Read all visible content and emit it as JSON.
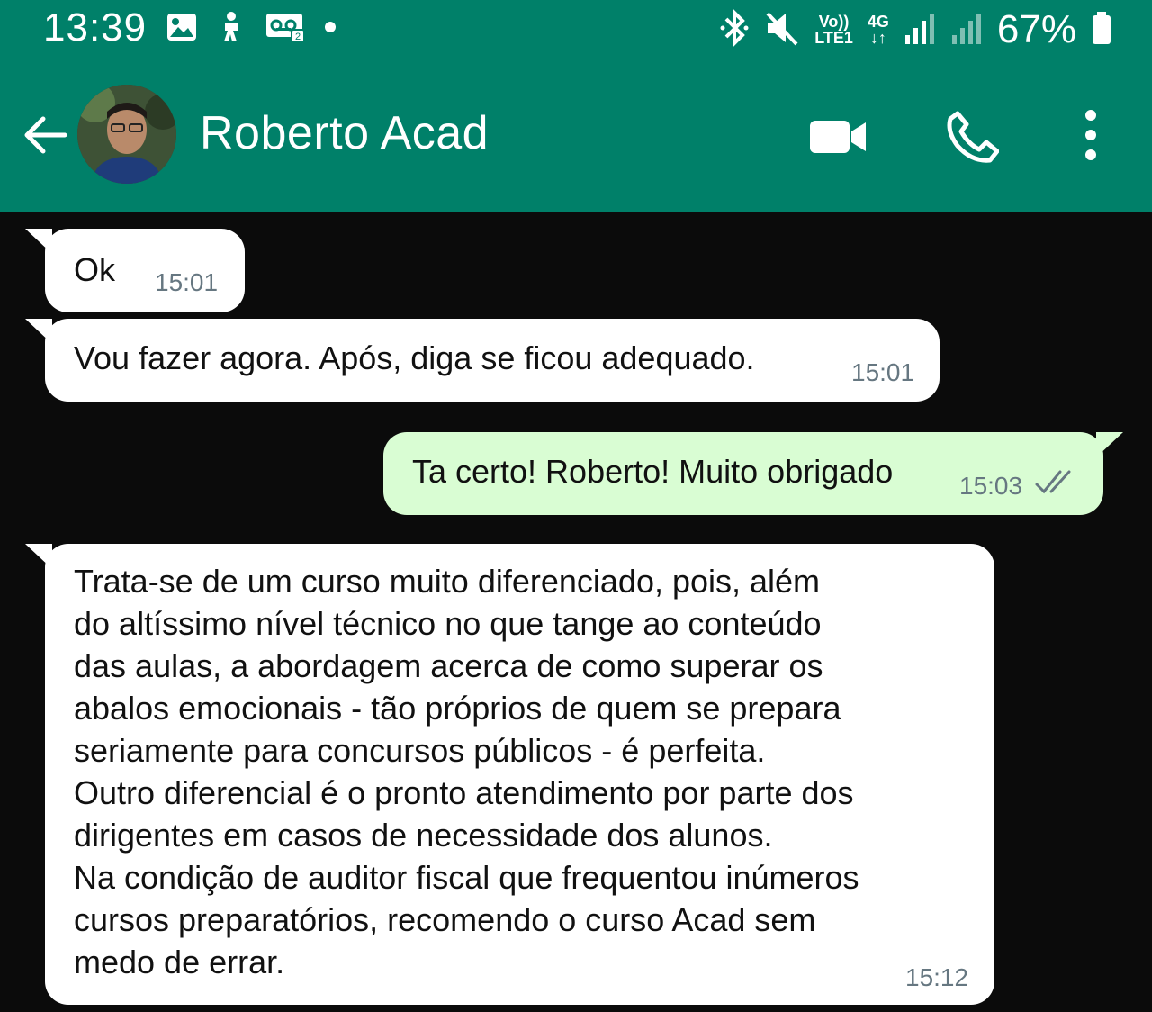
{
  "status_bar": {
    "time": "13:39",
    "left_icons": [
      "gallery-icon",
      "accessibility-icon",
      "voicemail-icon",
      "dot-icon"
    ],
    "volte": "Vo))",
    "lte": "LTE1",
    "network": "4G",
    "battery_percent": "67%"
  },
  "header": {
    "contact_name": "Roberto Acad",
    "icons": [
      "back-arrow-icon",
      "video-call-icon",
      "phone-call-icon",
      "more-options-icon"
    ]
  },
  "messages": [
    {
      "direction": "incoming",
      "text": "Ok",
      "time": "15:01"
    },
    {
      "direction": "incoming",
      "text": "Vou fazer agora. Após, diga se ficou adequado.",
      "time": "15:01"
    },
    {
      "direction": "outgoing",
      "text": "Ta certo! Roberto! Muito obrigado",
      "time": "15:03",
      "status": "read"
    },
    {
      "direction": "incoming",
      "lines": [
        "Trata-se de um curso muito diferenciado, pois, além",
        "do altíssimo nível técnico no que tange ao conteúdo",
        "das aulas, a abordagem acerca de como superar os",
        "abalos emocionais - tão próprios de quem se prepara",
        "seriamente para concursos públicos - é perfeita.",
        "Outro diferencial é o pronto atendimento por parte dos",
        "dirigentes em casos de necessidade dos alunos.",
        "Na condição de auditor fiscal que frequentou inúmeros",
        "cursos preparatórios, recomendo o curso Acad sem",
        "medo de errar."
      ],
      "time": "15:12"
    }
  ],
  "colors": {
    "header": "#008069",
    "chat_background": "#0b0b0b",
    "incoming_bubble": "#ffffff",
    "outgoing_bubble": "#d9fdd3",
    "timestamp": "#667781"
  }
}
